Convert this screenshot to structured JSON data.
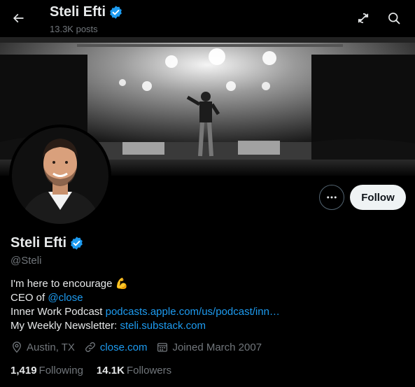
{
  "header": {
    "name": "Steli Efti",
    "posts": "13.3K posts",
    "icons": [
      "back-arrow-icon",
      "verified-badge-icon",
      "refresh-icon",
      "search-icon"
    ]
  },
  "actions": {
    "follow_label": "Follow",
    "more_icon": "more-icon"
  },
  "profile": {
    "name": "Steli Efti",
    "handle": "@Steli",
    "bio": {
      "line1_text": "I'm here to encourage",
      "line1_emoji": "💪",
      "line2_prefix": "CEO of ",
      "line2_link": "@close",
      "line3_prefix": "Inner Work Podcast ",
      "line3_link": "podcasts.apple.com/us/podcast/inn…",
      "line4_prefix": "My Weekly Newsletter: ",
      "line4_link": "steli.substack.com"
    },
    "location": "Austin, TX",
    "website": "close.com",
    "joined": "Joined March 2007",
    "following_count": "1,419",
    "following_label": "Following",
    "followers_count": "14.1K",
    "followers_label": "Followers"
  },
  "colors": {
    "background": "#000000",
    "accent": "#1d9bf0",
    "text": "#e7e9ea",
    "muted": "#71767b",
    "follow_button": "#eff3f4"
  }
}
